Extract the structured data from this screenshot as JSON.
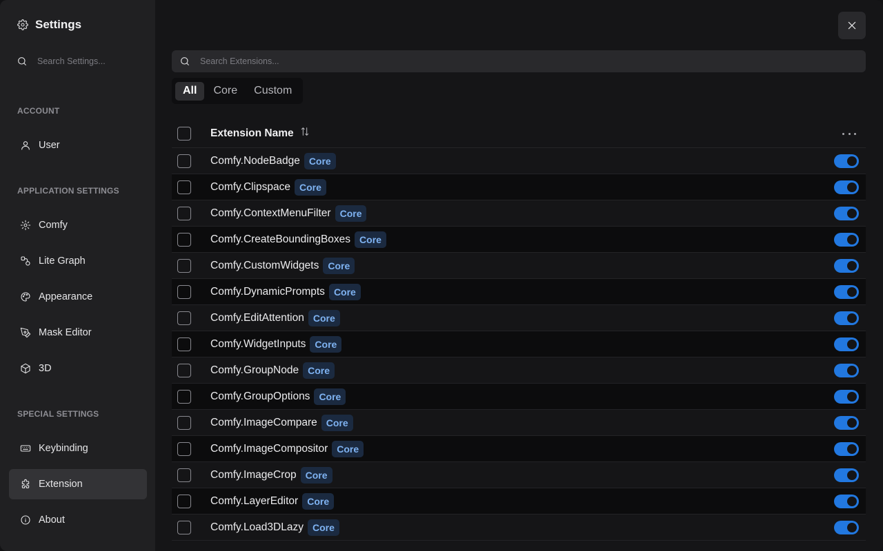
{
  "sidebar": {
    "title": "Settings",
    "search_placeholder": "Search Settings...",
    "sections": [
      {
        "label": "ACCOUNT",
        "items": [
          {
            "label": "User",
            "icon": "user-icon"
          }
        ]
      },
      {
        "label": "APPLICATION SETTINGS",
        "items": [
          {
            "label": "Comfy",
            "icon": "gear-icon"
          },
          {
            "label": "Lite Graph",
            "icon": "graph-nodes-icon"
          },
          {
            "label": "Appearance",
            "icon": "palette-icon"
          },
          {
            "label": "Mask Editor",
            "icon": "pen-tool-icon"
          },
          {
            "label": "3D",
            "icon": "cube-icon"
          }
        ]
      },
      {
        "label": "SPECIAL SETTINGS",
        "items": [
          {
            "label": "Keybinding",
            "icon": "keyboard-icon"
          },
          {
            "label": "Extension",
            "icon": "puzzle-icon",
            "active": true
          },
          {
            "label": "About",
            "icon": "info-icon"
          }
        ]
      }
    ]
  },
  "main": {
    "search_placeholder": "Search Extensions...",
    "filters": [
      {
        "label": "All",
        "active": true
      },
      {
        "label": "Core"
      },
      {
        "label": "Custom"
      }
    ],
    "table": {
      "header": "Extension Name",
      "rows": [
        {
          "name": "Comfy.NodeBadge",
          "badge": "Core",
          "enabled": true
        },
        {
          "name": "Comfy.Clipspace",
          "badge": "Core",
          "enabled": true
        },
        {
          "name": "Comfy.ContextMenuFilter",
          "badge": "Core",
          "enabled": true
        },
        {
          "name": "Comfy.CreateBoundingBoxes",
          "badge": "Core",
          "enabled": true
        },
        {
          "name": "Comfy.CustomWidgets",
          "badge": "Core",
          "enabled": true
        },
        {
          "name": "Comfy.DynamicPrompts",
          "badge": "Core",
          "enabled": true
        },
        {
          "name": "Comfy.EditAttention",
          "badge": "Core",
          "enabled": true
        },
        {
          "name": "Comfy.WidgetInputs",
          "badge": "Core",
          "enabled": true
        },
        {
          "name": "Comfy.GroupNode",
          "badge": "Core",
          "enabled": true
        },
        {
          "name": "Comfy.GroupOptions",
          "badge": "Core",
          "enabled": true
        },
        {
          "name": "Comfy.ImageCompare",
          "badge": "Core",
          "enabled": true
        },
        {
          "name": "Comfy.ImageCompositor",
          "badge": "Core",
          "enabled": true
        },
        {
          "name": "Comfy.ImageCrop",
          "badge": "Core",
          "enabled": true
        },
        {
          "name": "Comfy.LayerEditor",
          "badge": "Core",
          "enabled": true
        },
        {
          "name": "Comfy.Load3DLazy",
          "badge": "Core",
          "enabled": true
        }
      ]
    }
  },
  "colors": {
    "accent": "#2278e0",
    "badge_bg": "#1b2a40",
    "badge_text": "#7fb3f2",
    "sidebar_bg": "#202022",
    "main_bg": "#151517"
  }
}
